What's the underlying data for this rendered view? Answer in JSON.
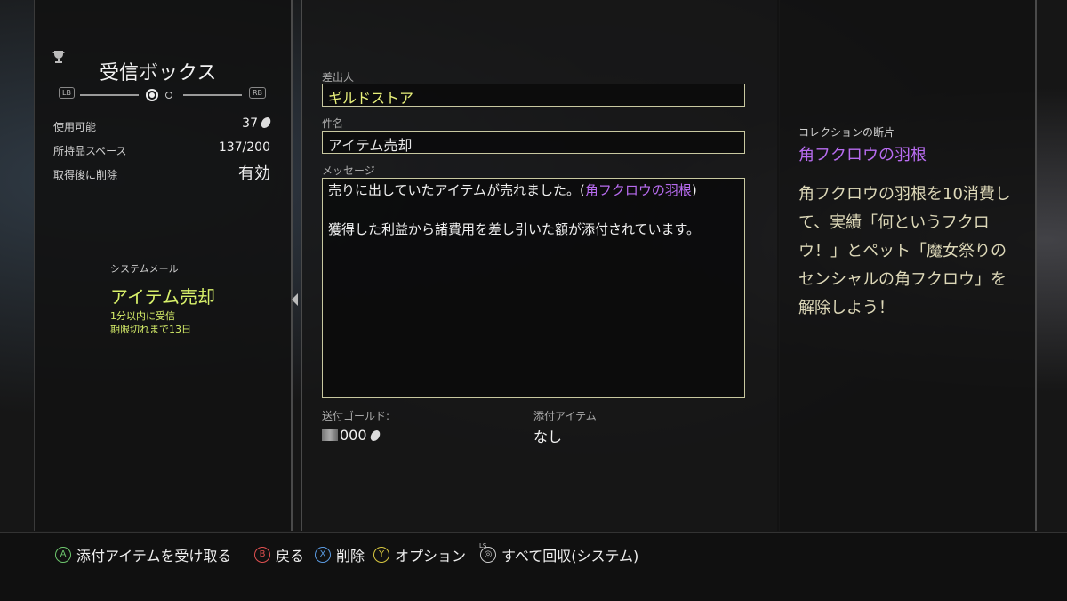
{
  "inbox": {
    "title": "受信ボックス",
    "lb": "LB",
    "rb": "RB",
    "stats": [
      {
        "label": "使用可能",
        "value": "37"
      },
      {
        "label": "所持品スペース",
        "value": "137/200"
      },
      {
        "label": "取得後に削除",
        "value": "有効"
      }
    ],
    "mail": {
      "category": "システムメール",
      "subject": "アイテム売却",
      "received": "1分以内に受信",
      "expires": "期限切れまで13日"
    }
  },
  "detail": {
    "sender_label": "差出人",
    "sender": "ギルドストア",
    "subject_label": "件名",
    "subject": "アイテム売却",
    "message_label": "メッセージ",
    "message_part1": "売りに出していたアイテムが売れました。(",
    "message_item": "角フクロウの羽根",
    "message_part2": ")",
    "message_line2": "獲得した利益から諸費用を差し引いた額が添付されています。",
    "gold_label": "送付ゴールド:",
    "gold_value": "000",
    "attach_label": "添付アイテム",
    "attach_value": "なし"
  },
  "collection": {
    "label": "コレクションの断片",
    "title": "角フクロウの羽根",
    "description": "角フクロウの羽根を10消費して、実績「何というフクロウ！」とペット「魔女祭りのセンシャルの角フクロウ」を解除しよう！"
  },
  "hints": [
    {
      "button": "A",
      "label": "添付アイテムを受け取る"
    },
    {
      "button": "B",
      "label": "戻る"
    },
    {
      "button": "X",
      "label": "削除"
    },
    {
      "button": "Y",
      "label": "オプション"
    },
    {
      "button": "LS",
      "label": "すべて回収(システム)"
    }
  ],
  "colors": {
    "accent_yellow": "#d8f06a",
    "accent_purple": "#b86cf0",
    "panel_border": "#c8c8a0"
  }
}
